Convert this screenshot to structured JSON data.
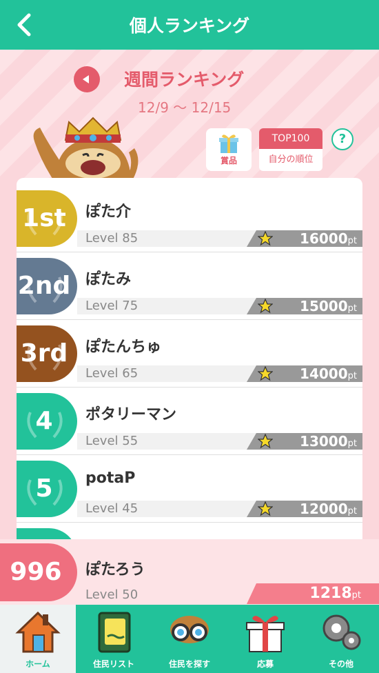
{
  "header": {
    "title": "個人ランキング"
  },
  "week": {
    "title": "週間ランキング",
    "range": "12/9 〜 12/15"
  },
  "buttons": {
    "prize": "賞品",
    "top100": "TOP100",
    "my_rank": "自分の順位",
    "help": "?"
  },
  "ranking": [
    {
      "rank_display": "1st",
      "name": "ぽた介",
      "level": "Level 85",
      "points": "16000",
      "color": "#d9b52a"
    },
    {
      "rank_display": "2nd",
      "name": "ぽたみ",
      "level": "Level 75",
      "points": "15000",
      "color": "#647a92"
    },
    {
      "rank_display": "3rd",
      "name": "ぽたんちゅ",
      "level": "Level 65",
      "points": "14000",
      "color": "#94521f"
    },
    {
      "rank_display": "4",
      "name": "ポタリーマン",
      "level": "Level 55",
      "points": "13000",
      "color": "#22c29a"
    },
    {
      "rank_display": "5",
      "name": "potaP",
      "level": "Level 45",
      "points": "12000",
      "color": "#22c29a"
    }
  ],
  "points_unit": "pt",
  "me": {
    "rank_display": "996",
    "name": "ぽたろう",
    "level": "Level 50",
    "points": "1218"
  },
  "nav": [
    {
      "label": "ホーム",
      "icon": "house-icon",
      "active": true
    },
    {
      "label": "住民リスト",
      "icon": "book-icon",
      "active": false
    },
    {
      "label": "住民を探す",
      "icon": "binoculars-icon",
      "active": false
    },
    {
      "label": "応募",
      "icon": "gift-icon",
      "active": false
    },
    {
      "label": "その他",
      "icon": "gears-icon",
      "active": false
    }
  ],
  "colors": {
    "accent": "#22c29a",
    "pink": "#e45b6b",
    "hero_bg": "#fde3e6"
  }
}
